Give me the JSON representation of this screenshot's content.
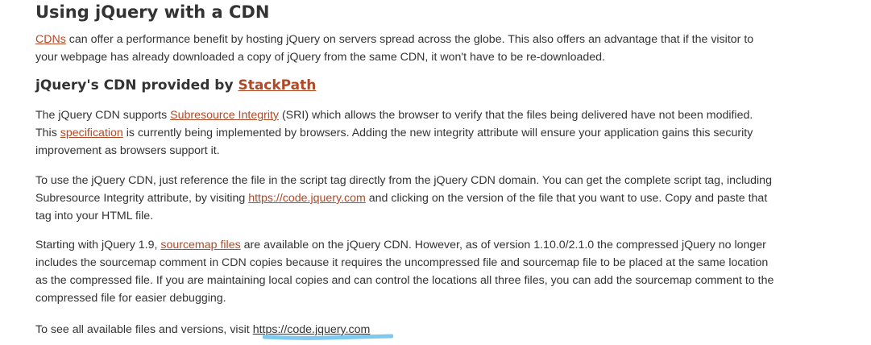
{
  "heading": "Using jQuery with a CDN",
  "intro": {
    "link_text": "CDNs",
    "text": " can offer a performance benefit by hosting jQuery on servers spread across the globe. This also offers an advantage that if the visitor to your webpage has already downloaded a copy of jQuery from the same CDN, it won't have to be re-downloaded."
  },
  "subheading": {
    "text": "jQuery's CDN provided by ",
    "link_text": "StackPath"
  },
  "para_sri": {
    "text_1": "The jQuery CDN supports ",
    "link_1": "Subresource Integrity",
    "text_2": " (SRI) which allows the browser to verify that the files being delivered have not been modified. This ",
    "link_2": "specification",
    "text_3": " is currently being implemented by browsers. Adding the new integrity attribute will ensure your application gains this security improvement as browsers support it."
  },
  "para_usage": {
    "text_1": "To use the jQuery CDN, just reference the file in the script tag directly from the jQuery CDN domain. You can get the complete script tag, including Subresource Integrity attribute, by visiting ",
    "link": "https://code.jquery.com",
    "text_2": " and clicking on the version of the file that you want to use. Copy and paste that tag into your HTML file."
  },
  "para_sourcemap": {
    "text_1": "Starting with jQuery 1.9, ",
    "link": "sourcemap files",
    "text_2": " are available on the jQuery CDN. However, as of version 1.10.0/2.1.0 the compressed jQuery no longer includes the sourcemap comment in CDN copies because it requires the uncompressed file and sourcemap file to be placed at the same location as the compressed file. If you are maintaining local copies and can control the locations all three files, you can add the sourcemap comment to the compressed file for easier debugging."
  },
  "para_versions": {
    "text": "To see all available files and versions, visit ",
    "link": "https://code.jquery.com"
  },
  "colors": {
    "link": "#b24926",
    "text": "#333333",
    "highlight": "#7dc9f0"
  }
}
